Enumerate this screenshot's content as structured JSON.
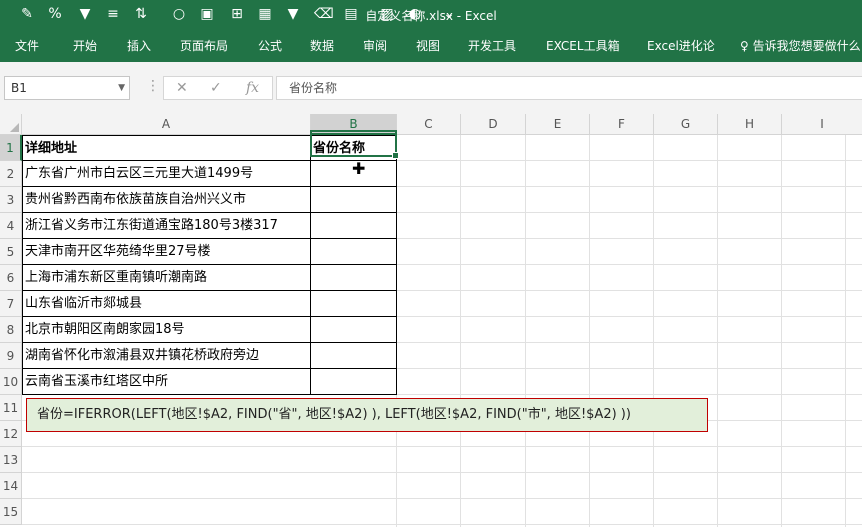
{
  "window": {
    "title": "自定义名称.xlsx - Excel"
  },
  "ribbon": {
    "tabs": [
      "文件",
      "开始",
      "插入",
      "页面布局",
      "公式",
      "数据",
      "审阅",
      "视图",
      "开发工具",
      "EXCEL工具箱",
      "Excel进化论"
    ],
    "tell_me": "告诉我您想要做什么"
  },
  "formula_bar": {
    "name_box": "B1",
    "formula": "省份名称",
    "fx": "fx"
  },
  "columns": [
    "A",
    "B",
    "C",
    "D",
    "E",
    "F",
    "G",
    "H",
    "I"
  ],
  "rows": [
    "1",
    "2",
    "3",
    "4",
    "5",
    "6",
    "7",
    "8",
    "9",
    "10",
    "11",
    "12",
    "13",
    "14",
    "15"
  ],
  "sheet": {
    "header_a": "详细地址",
    "header_b": "省份名称",
    "addresses": [
      "广东省广州市白云区三元里大道1499号",
      "贵州省黔西南布依族苗族自治州兴义市",
      "浙江省义务市江东街道通宝路180号3楼317",
      "天津市南开区华苑绮华里27号楼",
      "上海市浦东新区重南镇听潮南路",
      "山东省临沂市郯城县",
      "北京市朝阳区南朗家园18号",
      "湖南省怀化市溆浦县双井镇花桥政府旁边",
      "云南省玉溪市红塔区中所"
    ]
  },
  "note": "省份=IFERROR(LEFT(地区!$A2, FIND(\"省\", 地区!$A2) ), LEFT(地区!$A2, FIND(\"市\", 地区!$A2) ))",
  "colors": {
    "accent": "#217346",
    "note_bg": "#e2efda",
    "note_border": "#c00000"
  }
}
